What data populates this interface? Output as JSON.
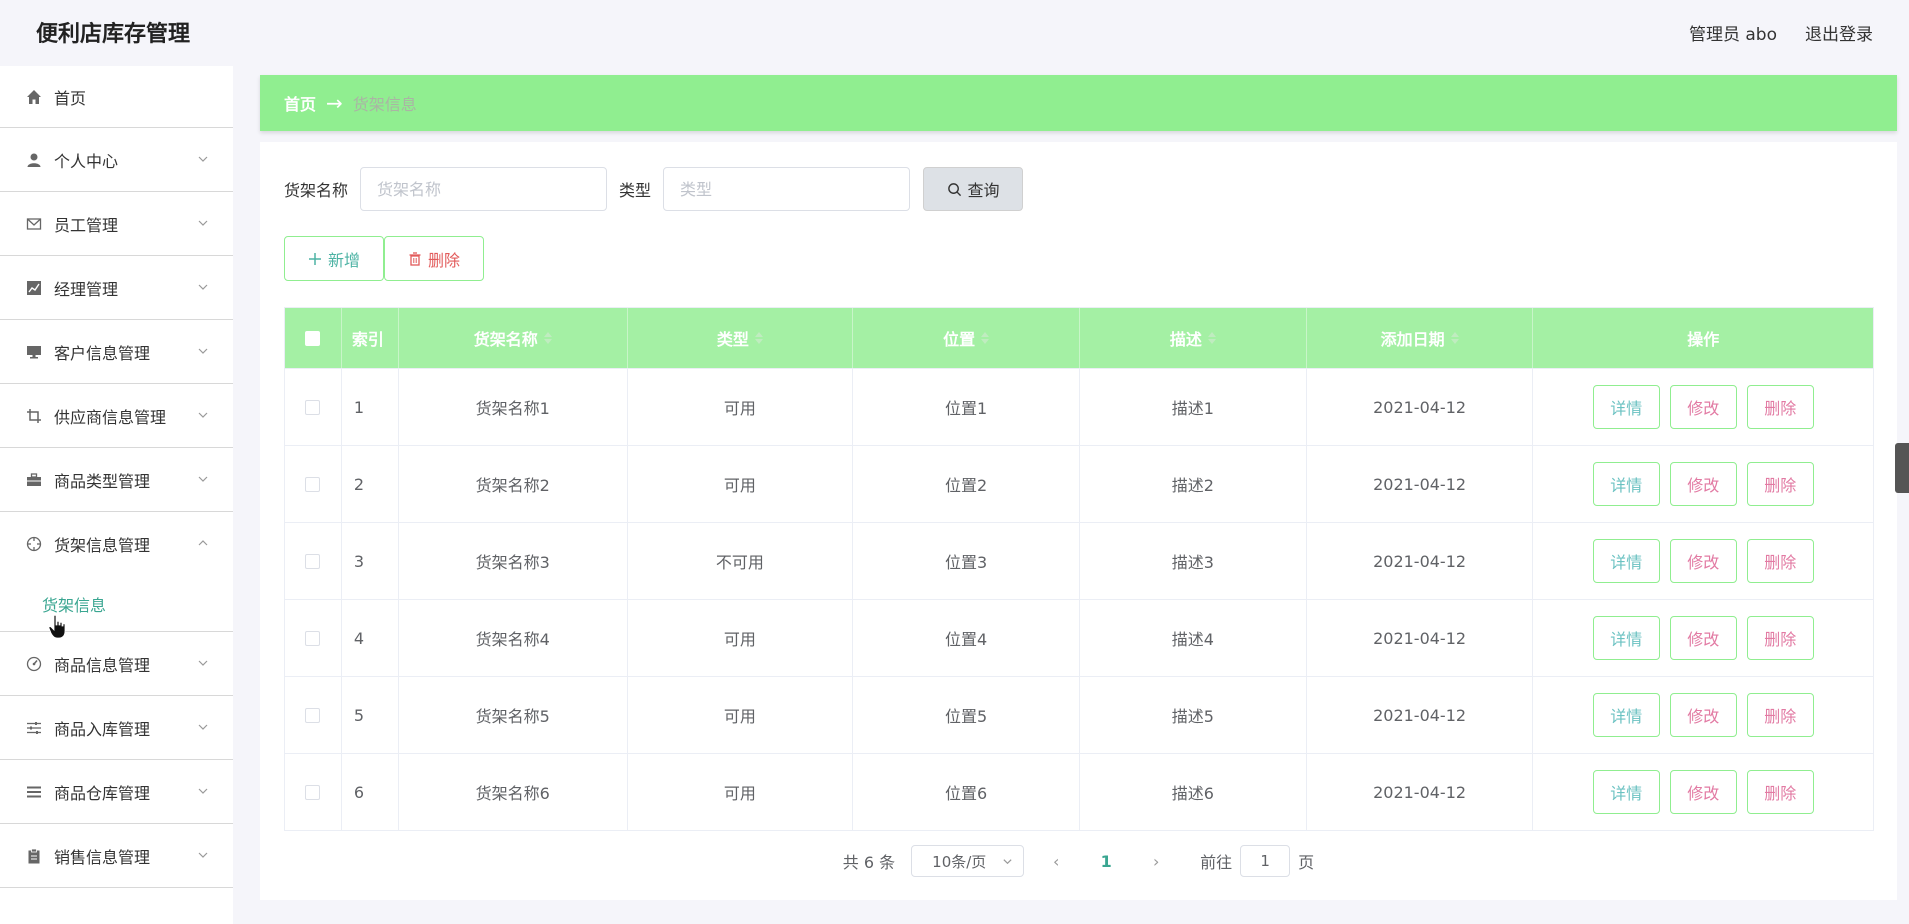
{
  "header": {
    "app_title": "便利店库存管理",
    "user_label": "管理员 abo",
    "logout_label": "退出登录"
  },
  "sidebar": {
    "items": [
      {
        "label": "首页",
        "icon": "home-icon",
        "has_children": false
      },
      {
        "label": "个人中心",
        "icon": "user-icon",
        "has_children": true
      },
      {
        "label": "员工管理",
        "icon": "mail-icon",
        "has_children": true
      },
      {
        "label": "经理管理",
        "icon": "chart-icon",
        "has_children": true
      },
      {
        "label": "客户信息管理",
        "icon": "monitor-icon",
        "has_children": true
      },
      {
        "label": "供应商信息管理",
        "icon": "crop-icon",
        "has_children": true
      },
      {
        "label": "商品类型管理",
        "icon": "briefcase-icon",
        "has_children": true
      },
      {
        "label": "货架信息管理",
        "icon": "target-icon",
        "has_children": true,
        "expanded": true
      },
      {
        "label": "商品信息管理",
        "icon": "gauge-icon",
        "has_children": true
      },
      {
        "label": "商品入库管理",
        "icon": "sliders-icon",
        "has_children": true
      },
      {
        "label": "商品仓库管理",
        "icon": "list-icon",
        "has_children": true
      },
      {
        "label": "销售信息管理",
        "icon": "clipboard-icon",
        "has_children": true
      }
    ],
    "sub_item": "货架信息"
  },
  "breadcrumb": {
    "home": "首页",
    "arrow": "→",
    "current": "货架信息"
  },
  "search": {
    "name_label": "货架名称",
    "name_placeholder": "货架名称",
    "type_label": "类型",
    "type_placeholder": "类型",
    "query_label": "查询"
  },
  "actions": {
    "add_label": "新增",
    "delete_label": "删除"
  },
  "table": {
    "columns": [
      "索引",
      "货架名称",
      "类型",
      "位置",
      "描述",
      "添加日期",
      "操作"
    ],
    "rows": [
      {
        "index": "1",
        "name": "货架名称1",
        "type": "可用",
        "location": "位置1",
        "desc": "描述1",
        "date": "2021-04-12"
      },
      {
        "index": "2",
        "name": "货架名称2",
        "type": "可用",
        "location": "位置2",
        "desc": "描述2",
        "date": "2021-04-12"
      },
      {
        "index": "3",
        "name": "货架名称3",
        "type": "不可用",
        "location": "位置3",
        "desc": "描述3",
        "date": "2021-04-12"
      },
      {
        "index": "4",
        "name": "货架名称4",
        "type": "可用",
        "location": "位置4",
        "desc": "描述4",
        "date": "2021-04-12"
      },
      {
        "index": "5",
        "name": "货架名称5",
        "type": "可用",
        "location": "位置5",
        "desc": "描述5",
        "date": "2021-04-12"
      },
      {
        "index": "6",
        "name": "货架名称6",
        "type": "可用",
        "location": "位置6",
        "desc": "描述6",
        "date": "2021-04-12"
      }
    ],
    "row_actions": {
      "detail": "详情",
      "edit": "修改",
      "remove": "删除"
    }
  },
  "pagination": {
    "total": "共 6 条",
    "page_size": "10条/页",
    "current_page": "1",
    "goto_label": "前往",
    "goto_value": "1",
    "page_suffix": "页"
  },
  "colors": {
    "accent_green": "#90ee90",
    "header_green": "#a4f0a4",
    "teal": "#3aa691"
  }
}
